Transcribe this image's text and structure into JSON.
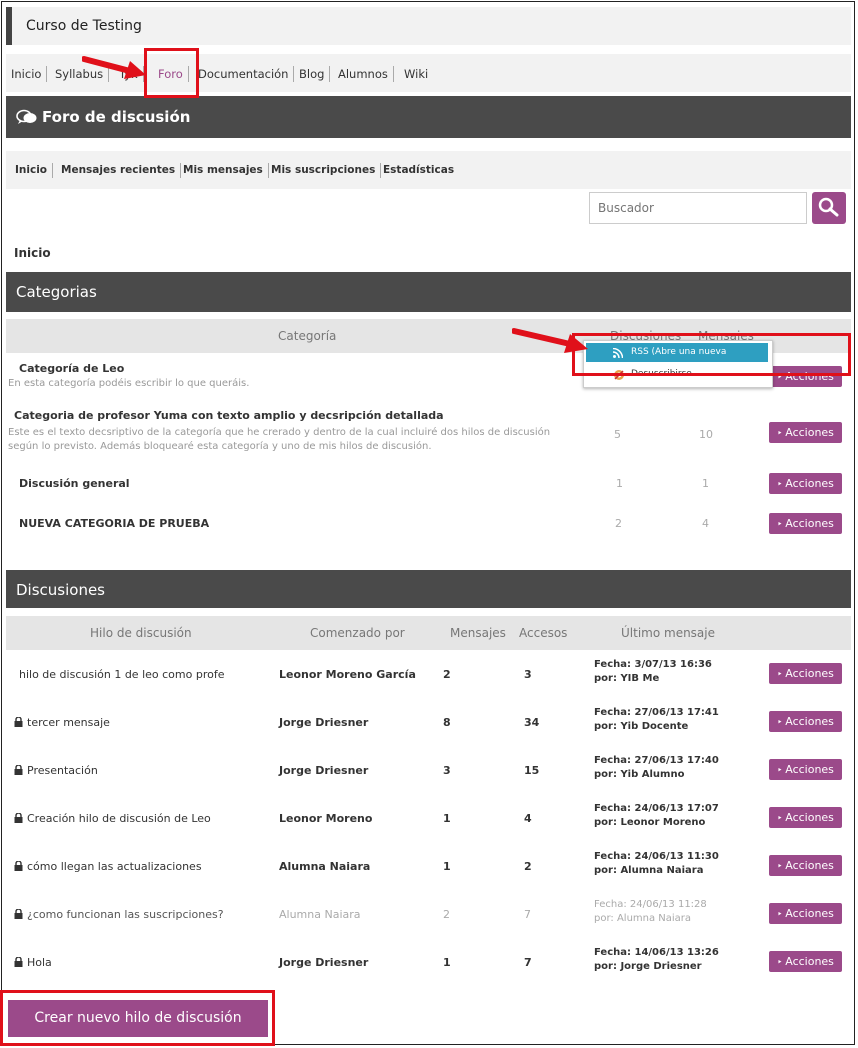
{
  "site": {
    "title": "Curso de Testing"
  },
  "main_nav": [
    "Inicio",
    "Syllabus",
    "Tyk",
    "Foro",
    "Documentación",
    "Blog",
    "Alumnos",
    "Wiki"
  ],
  "forum": {
    "title": "Foro de discusión",
    "nav": [
      "Inicio",
      "Mensajes recientes",
      "Mis mensajes",
      "Mis suscripciones",
      "Estadísticas"
    ],
    "search_placeholder": "Buscador",
    "breadcrumb": "Inicio"
  },
  "categories": {
    "header": "Categorias",
    "columns": {
      "category": "Categoría",
      "discussions": "Discusiones",
      "messages": "Mensajes"
    },
    "rows": [
      {
        "name": "Categoría de Leo",
        "desc": "En esta categoría podéis escribir lo que queráis.",
        "desc2": "",
        "discussions": "",
        "messages": "",
        "action": "Acciones"
      },
      {
        "name": "Categoria de profesor Yuma con texto amplio y decsripción detallada",
        "desc": "Este es el texto decsriptivo de la categoría que he crerado y dentro de la cual incluiré dos hilos de discusión",
        "desc2": "según lo previsto. Además bloquearé esta categoría y uno de mis hilos de discusión.",
        "discussions": "5",
        "messages": "10",
        "action": "Acciones"
      },
      {
        "name": "Discusión general",
        "desc": "",
        "desc2": "",
        "discussions": "1",
        "messages": "1",
        "action": "Acciones"
      },
      {
        "name": "NUEVA CATEGORIA DE PRUEBA",
        "desc": "",
        "desc2": "",
        "discussions": "2",
        "messages": "4",
        "action": "Acciones"
      }
    ],
    "dropdown": {
      "rss": "RSS (Abre una nueva ventana)",
      "unsubscribe": "Desuscribirse"
    }
  },
  "discussions": {
    "header": "Discusiones",
    "columns": {
      "thread": "Hilo de discusión",
      "started_by": "Comenzado por",
      "messages": "Mensajes",
      "accesses": "Accesos",
      "last": "Último mensaje"
    },
    "rows": [
      {
        "title": "hilo de discusión 1 de leo como profe",
        "locked": false,
        "muted": false,
        "author": "Leonor Moreno García",
        "messages": "2",
        "accesses": "3",
        "last_date": "Fecha: 3/07/13 16:36",
        "last_by": "por: YIB Me",
        "action": "Acciones"
      },
      {
        "title": "tercer mensaje",
        "locked": true,
        "muted": false,
        "author": "Jorge Driesner",
        "messages": "8",
        "accesses": "34",
        "last_date": "Fecha: 27/06/13 17:41",
        "last_by": "por: Yib Docente",
        "action": "Acciones"
      },
      {
        "title": "Presentación",
        "locked": true,
        "muted": false,
        "author": "Jorge Driesner",
        "messages": "3",
        "accesses": "15",
        "last_date": "Fecha: 27/06/13 17:40",
        "last_by": "por: Yib Alumno",
        "action": "Acciones"
      },
      {
        "title": "Creación hilo de discusión de Leo",
        "locked": true,
        "muted": false,
        "author": "Leonor Moreno",
        "messages": "1",
        "accesses": "4",
        "last_date": "Fecha: 24/06/13 17:07",
        "last_by": "por: Leonor Moreno",
        "action": "Acciones"
      },
      {
        "title": "cómo llegan las actualizaciones",
        "locked": true,
        "muted": false,
        "author": "Alumna Naiara",
        "messages": "1",
        "accesses": "2",
        "last_date": "Fecha: 24/06/13 11:30",
        "last_by": "por: Alumna Naiara",
        "action": "Acciones"
      },
      {
        "title": "¿como funcionan las suscripciones?",
        "locked": true,
        "muted": true,
        "author": "Alumna Naiara",
        "messages": "2",
        "accesses": "7",
        "last_date": "Fecha: 24/06/13 11:28",
        "last_by": "por: Alumna Naiara",
        "action": "Acciones"
      },
      {
        "title": "Hola",
        "locked": true,
        "muted": false,
        "author": "Jorge Driesner",
        "messages": "1",
        "accesses": "7",
        "last_date": "Fecha: 14/06/13 13:26",
        "last_by": "por: Jorge Driesner",
        "action": "Acciones"
      }
    ],
    "create_button": "Crear nuevo hilo de discusión"
  },
  "colors": {
    "accent": "#9b4a8a",
    "header_bg": "#4a4a4a",
    "highlight": "#e0101a",
    "dropdown_active": "#2e9fc1"
  },
  "icons": [
    "search-icon",
    "chat-bubbles-icon",
    "rss-icon",
    "unsubscribe-icon",
    "lock-icon",
    "red-arrow-icon"
  ]
}
